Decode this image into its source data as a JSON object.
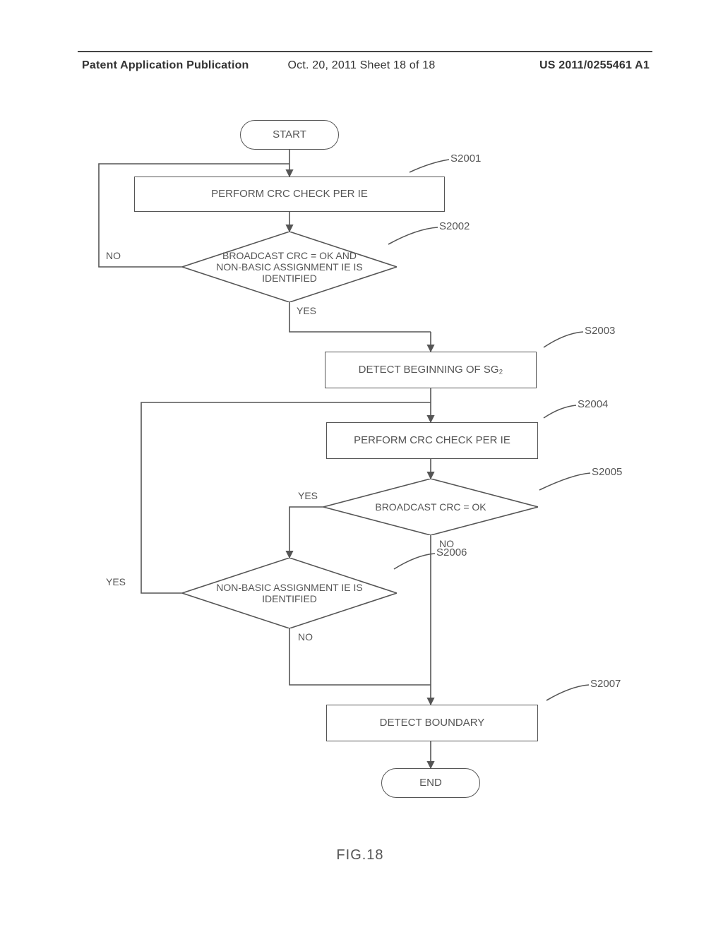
{
  "header": {
    "left": "Patent Application Publication",
    "center": "Oct. 20, 2011   Sheet 18 of 18",
    "right": "US 2011/0255461 A1"
  },
  "chart_data": {
    "type": "flowchart",
    "title": "FIG.18",
    "nodes": [
      {
        "id": "start",
        "kind": "terminator",
        "label": "START"
      },
      {
        "id": "s2001",
        "kind": "process",
        "label": "PERFORM CRC CHECK PER IE",
        "step": "S2001"
      },
      {
        "id": "s2002",
        "kind": "decision",
        "label": "BROADCAST CRC = OK AND NON-BASIC ASSIGNMENT IE IS IDENTIFIED",
        "step": "S2002",
        "yes_dir": "down",
        "no_dir": "left"
      },
      {
        "id": "s2003",
        "kind": "process",
        "label": "DETECT BEGINNING OF SG₂",
        "step": "S2003"
      },
      {
        "id": "s2004",
        "kind": "process",
        "label": "PERFORM CRC CHECK PER IE",
        "step": "S2004"
      },
      {
        "id": "s2005",
        "kind": "decision",
        "label": "BROADCAST CRC = OK",
        "step": "S2005",
        "yes_dir": "left",
        "no_dir": "down"
      },
      {
        "id": "s2006",
        "kind": "decision",
        "label": "NON-BASIC ASSIGNMENT IE IS IDENTIFIED",
        "step": "S2006",
        "yes_dir": "left",
        "no_dir": "down"
      },
      {
        "id": "s2007",
        "kind": "process",
        "label": "DETECT BOUNDARY",
        "step": "S2007"
      },
      {
        "id": "end",
        "kind": "terminator",
        "label": "END"
      }
    ],
    "edges": [
      {
        "from": "start",
        "to": "s2001"
      },
      {
        "from": "s2001",
        "to": "s2002"
      },
      {
        "from": "s2002",
        "to": "s2003",
        "cond": "YES"
      },
      {
        "from": "s2002",
        "to": "s2001",
        "cond": "NO"
      },
      {
        "from": "s2003",
        "to": "s2004"
      },
      {
        "from": "s2004",
        "to": "s2005"
      },
      {
        "from": "s2005",
        "to": "s2006",
        "cond": "YES"
      },
      {
        "from": "s2005",
        "to": "s2007",
        "cond": "NO"
      },
      {
        "from": "s2006",
        "to": "s2004",
        "cond": "YES"
      },
      {
        "from": "s2006",
        "to": "s2007",
        "cond": "NO"
      },
      {
        "from": "s2007",
        "to": "end"
      }
    ]
  },
  "branch_labels": {
    "yes": "YES",
    "no": "NO"
  }
}
